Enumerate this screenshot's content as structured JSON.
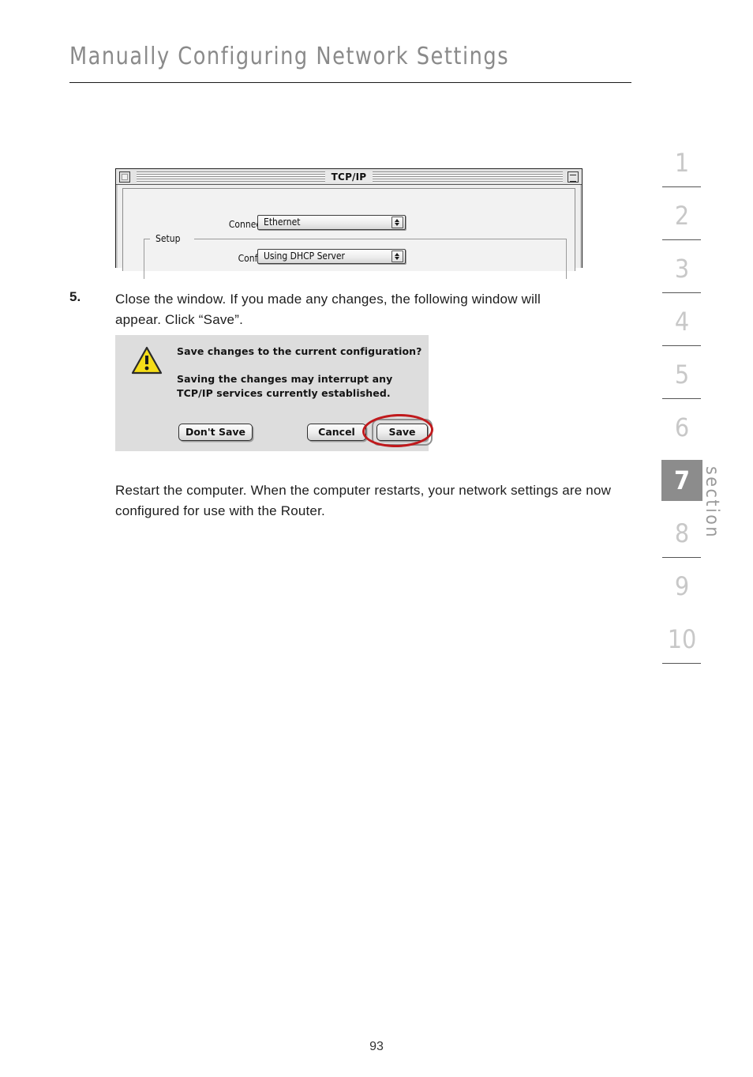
{
  "header": {
    "title": "Manually Configuring Network Settings"
  },
  "section_rail": {
    "items": [
      {
        "label": "1",
        "active": false
      },
      {
        "label": "2",
        "active": false
      },
      {
        "label": "3",
        "active": false
      },
      {
        "label": "4",
        "active": false
      },
      {
        "label": "5",
        "active": false
      },
      {
        "label": "6",
        "active": false
      },
      {
        "label": "7",
        "active": true
      },
      {
        "label": "8",
        "active": false
      },
      {
        "label": "9",
        "active": false
      },
      {
        "label": "10",
        "active": false
      }
    ],
    "word": "section",
    "active_bg": "#8c8c8c",
    "inactive_color": "#c8c8c8"
  },
  "tcpip_window": {
    "title": "TCP/IP",
    "connect_via_label": "Connect via :",
    "connect_via_value": "Ethernet",
    "setup_group_label": "Setup",
    "configure_label": "Configure :",
    "configure_value": "Using DHCP Server"
  },
  "step5": {
    "number": "5.",
    "text": "Close the window. If you made any changes, the following window will appear. Click “Save”."
  },
  "save_dialog": {
    "icon": "warning-triangle-icon",
    "line1": "Save changes to the current configuration?",
    "line2": "Saving the changes may interrupt any TCP/IP services currently established.",
    "buttons": {
      "dont_save": "Don't Save",
      "cancel": "Cancel",
      "save": "Save"
    },
    "highlight_color": "#c0191c",
    "warning_fill": "#f5dd18"
  },
  "restart_paragraph": "Restart the computer. When the computer restarts, your network settings are now configured for use with the Router.",
  "footer": {
    "page_number": "93"
  }
}
